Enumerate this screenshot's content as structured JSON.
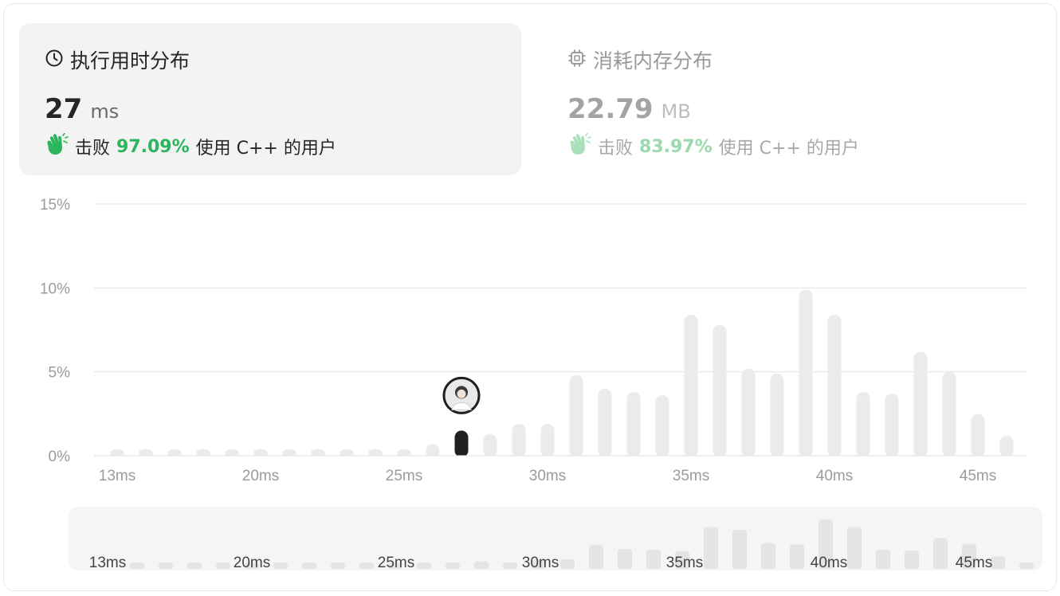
{
  "runtime": {
    "title": "执行用时分布",
    "value": "27",
    "unit": "ms",
    "beat_prefix": "击败",
    "beat_percent": "97.09%",
    "beat_suffix": "使用 C++ 的用户",
    "icon": "clock-icon"
  },
  "memory": {
    "title": "消耗内存分布",
    "value": "22.79",
    "unit": "MB",
    "beat_prefix": "击败",
    "beat_percent": "83.97%",
    "beat_suffix": "使用 C++ 的用户",
    "icon": "chip-icon"
  },
  "colors": {
    "accent_green": "#2db55d",
    "bar_default": "#ebebeb",
    "bar_highlight": "#1f1f1f",
    "gridline": "#e6e6e6"
  },
  "chart_data": {
    "type": "bar",
    "ylabel_ticks": [
      "0%",
      "5%",
      "10%",
      "15%"
    ],
    "ylim": [
      0,
      15
    ],
    "x_tick_labels": [
      "13ms",
      "20ms",
      "25ms",
      "30ms",
      "35ms",
      "40ms",
      "45ms"
    ],
    "x_tick_values": [
      13,
      18,
      23,
      28,
      33,
      38,
      43
    ],
    "x": [
      13,
      14,
      15,
      16,
      17,
      18,
      19,
      20,
      21,
      22,
      23,
      24,
      25,
      26,
      27,
      28,
      29,
      30,
      31,
      32,
      33,
      34,
      35,
      36,
      37,
      38,
      39,
      40,
      41,
      42,
      43,
      44
    ],
    "values": [
      0.4,
      0.4,
      0.4,
      0.4,
      0.4,
      0.4,
      0.4,
      0.4,
      0.4,
      0.4,
      0.4,
      0.7,
      1.5,
      1.3,
      1.9,
      1.9,
      4.8,
      4.0,
      3.8,
      3.6,
      8.4,
      7.8,
      5.2,
      4.9,
      9.9,
      8.4,
      3.8,
      3.7,
      6.2,
      5.0,
      2.5,
      1.2
    ],
    "highlight_x": 25,
    "grid": true,
    "overview": {
      "x_tick_labels": [
        "13ms",
        "20ms",
        "25ms",
        "30ms",
        "35ms",
        "40ms",
        "45ms"
      ]
    }
  }
}
